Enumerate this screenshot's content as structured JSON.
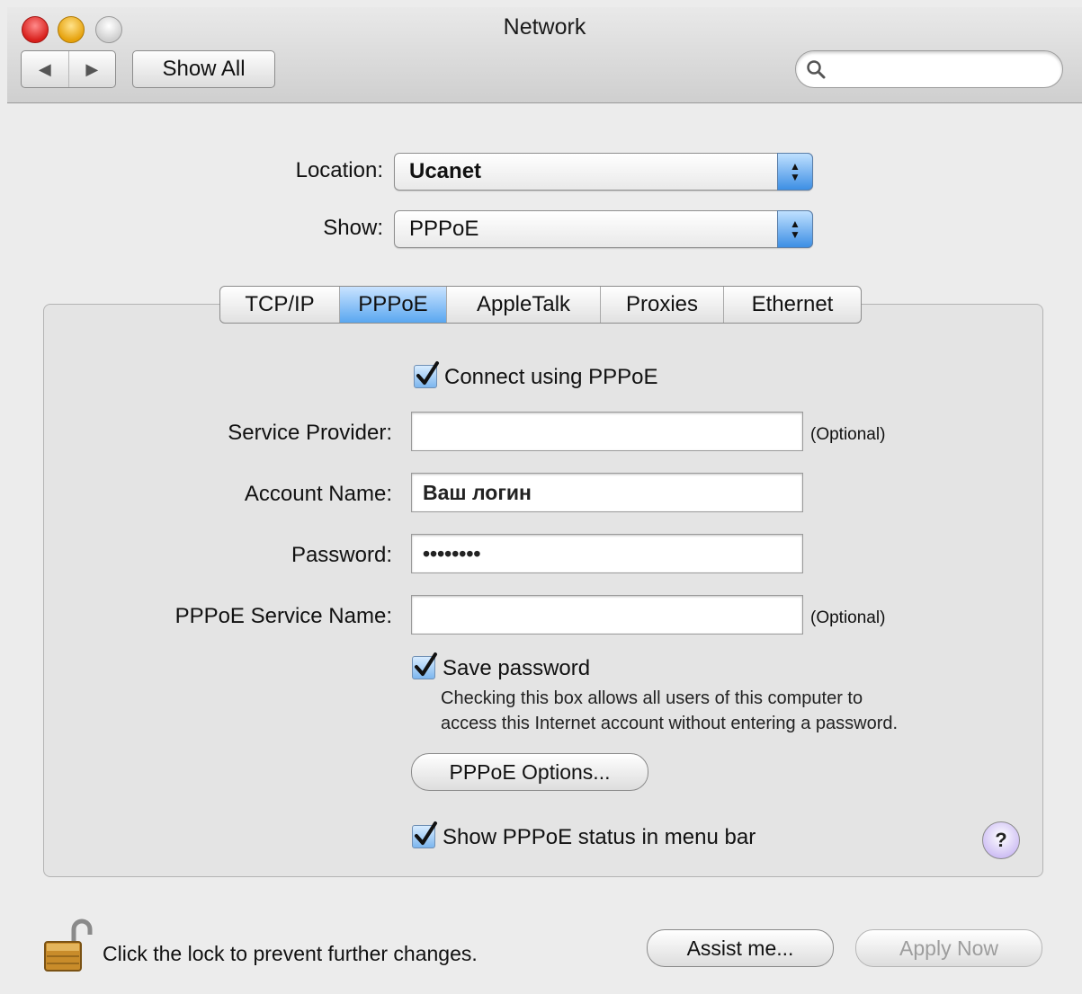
{
  "window": {
    "title": "Network"
  },
  "toolbar": {
    "back_glyph": "◀",
    "forward_glyph": "▶",
    "show_all_label": "Show All",
    "search_placeholder": ""
  },
  "location": {
    "label": "Location:",
    "value": "Ucanet"
  },
  "show": {
    "label": "Show:",
    "value": "PPPoE"
  },
  "tabs": [
    {
      "label": "TCP/IP",
      "active": false
    },
    {
      "label": "PPPoE",
      "active": true
    },
    {
      "label": "AppleTalk",
      "active": false
    },
    {
      "label": "Proxies",
      "active": false
    },
    {
      "label": "Ethernet",
      "active": false
    }
  ],
  "pppoe": {
    "connect_label": "Connect using PPPoE",
    "connect_checked": true,
    "service_provider": {
      "label": "Service Provider:",
      "value": "",
      "hint": "(Optional)"
    },
    "account_name": {
      "label": "Account Name:",
      "value": "Ваш логин"
    },
    "password": {
      "label": "Password:",
      "value": "••••••••"
    },
    "service_name": {
      "label": "PPPoE Service Name:",
      "value": "",
      "hint": "(Optional)"
    },
    "save_password_label": "Save password",
    "save_password_checked": true,
    "save_password_note_1": "Checking this box allows all users of this computer to",
    "save_password_note_2": "access this Internet account without entering a password.",
    "options_button": "PPPoE Options...",
    "status_label": "Show PPPoE status in menu bar",
    "status_checked": true,
    "help_glyph": "?"
  },
  "footer": {
    "lock_text": "Click the lock to prevent further changes.",
    "assist_button": "Assist me...",
    "apply_button": "Apply Now"
  },
  "colors": {
    "tab_active": "#5aa7f0",
    "popup_arrows": "#3d8fe4",
    "traffic_close": "#d8201c",
    "traffic_min": "#e6a20d",
    "help_bg": "#cdbdf4"
  }
}
